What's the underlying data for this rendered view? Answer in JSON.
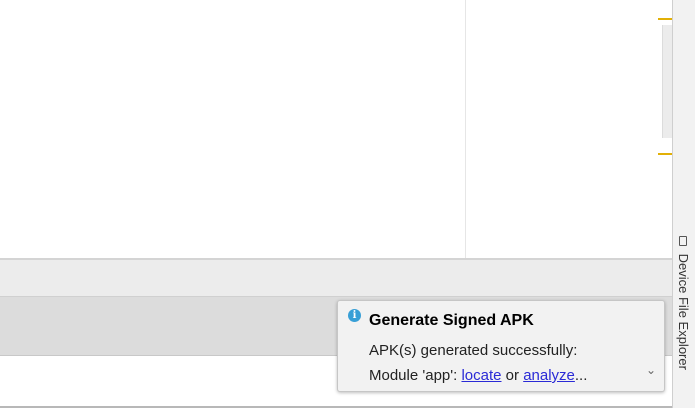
{
  "notification": {
    "title": "Generate Signed APK",
    "line1": "APK(s) generated successfully:",
    "line2_prefix": "Module 'app': ",
    "link_locate": "locate",
    "link_separator": " or ",
    "link_analyze": "analyze",
    "ellipsis": "...",
    "icon": "info-icon",
    "expand_icon": "chevron-down-icon"
  },
  "right_sidebar": {
    "tab_label": "Device File Explorer",
    "tab_icon": "device-icon"
  },
  "colors": {
    "accent_marker": "#e2b007",
    "link": "#2a2ad6",
    "info_icon": "#389fd6"
  }
}
